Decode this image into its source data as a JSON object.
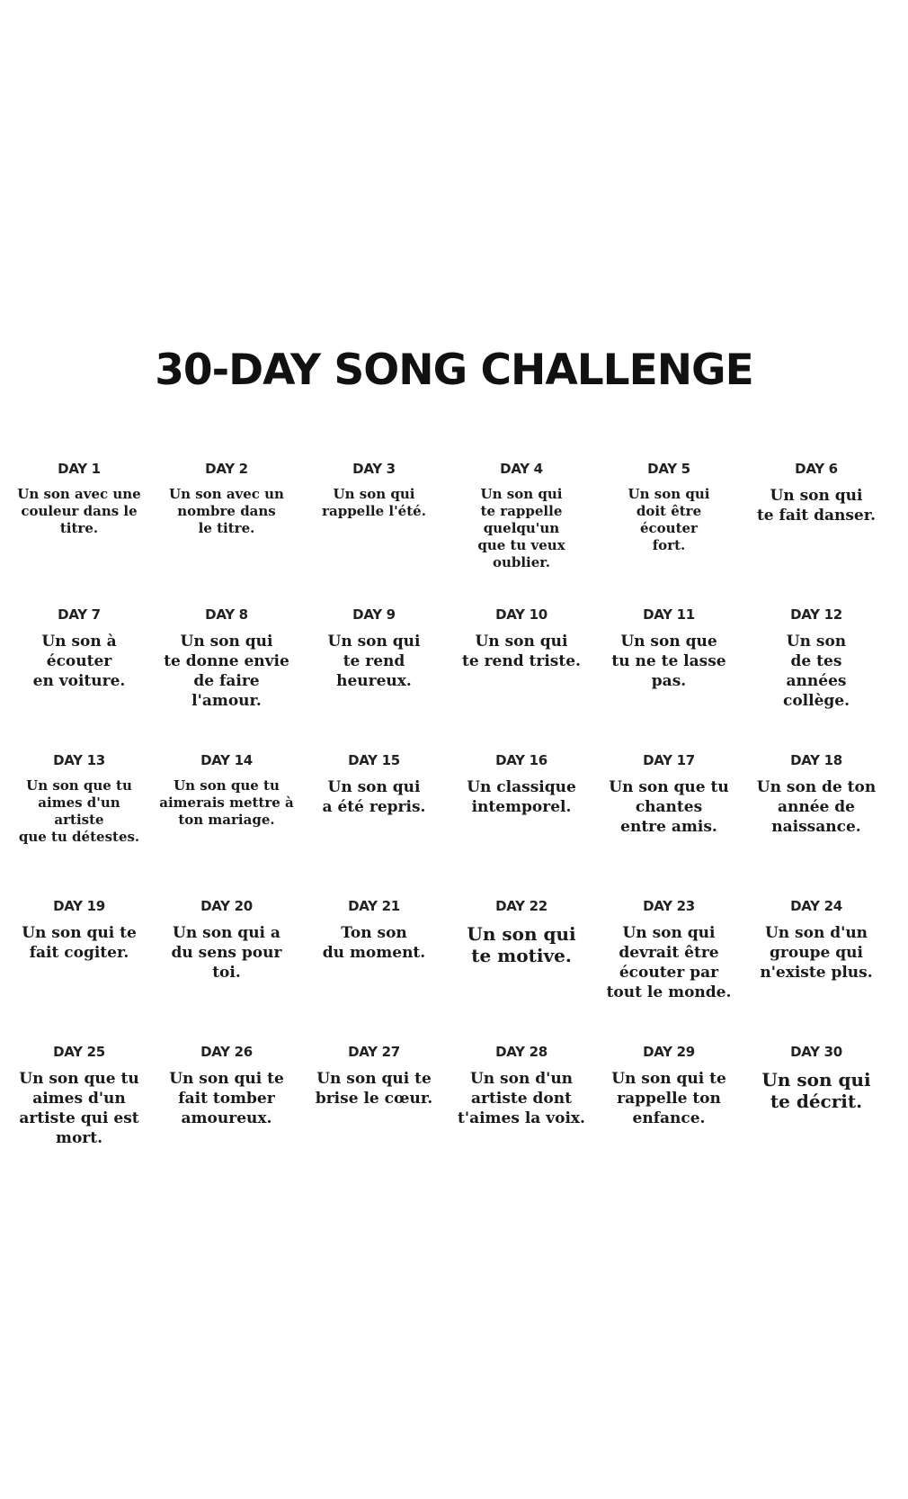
{
  "title": "30-DAY SONG CHALLENGE",
  "days": [
    {
      "label": "DAY 1",
      "text": "Un son avec une\ncouleur dans le\ntitre."
    },
    {
      "label": "DAY 2",
      "text": "Un son avec un\nnombre dans\nle titre."
    },
    {
      "label": "DAY 3",
      "text": "Un son qui\nrappelle l'été."
    },
    {
      "label": "DAY 4",
      "text": "Un son qui\nte rappelle\nquelqu'un\nque tu veux\noublier."
    },
    {
      "label": "DAY 5",
      "text": "Un son qui\ndoit être\nécouter\nfort."
    },
    {
      "label": "DAY 6",
      "text": "Un son qui\nte fait danser."
    },
    {
      "label": "DAY 7",
      "text": "Un son à\nécouter\nen voiture."
    },
    {
      "label": "DAY 8",
      "text": "Un son qui\nte donne envie\nde faire l'amour."
    },
    {
      "label": "DAY 9",
      "text": "Un son qui\nte rend\nheureux."
    },
    {
      "label": "DAY 10",
      "text": "Un son qui\nte rend triste."
    },
    {
      "label": "DAY 11",
      "text": "Un son que\ntu ne te lasse\npas."
    },
    {
      "label": "DAY 12",
      "text": "Un son\nde tes\nannées\ncollège."
    },
    {
      "label": "DAY 13",
      "text": "Un son que tu\naimes d'un\nartiste\nque tu détestes."
    },
    {
      "label": "DAY 14",
      "text": "Un son que tu\naimerais mettre à\nton mariage."
    },
    {
      "label": "DAY 15",
      "text": "Un son qui\na été repris."
    },
    {
      "label": "DAY 16",
      "text": "Un classique\nintemporel."
    },
    {
      "label": "DAY 17",
      "text": "Un son que tu\nchantes\nentre amis."
    },
    {
      "label": "DAY 18",
      "text": "Un son de ton\nannée de\nnaissance."
    },
    {
      "label": "DAY 19",
      "text": "Un son qui te\nfait cogiter."
    },
    {
      "label": "DAY 20",
      "text": "Un son qui a\ndu sens pour\ntoi."
    },
    {
      "label": "DAY 21",
      "text": "Ton son\ndu moment."
    },
    {
      "label": "DAY 22",
      "text": "Un son qui\nte motive."
    },
    {
      "label": "DAY 23",
      "text": "Un son qui\ndevrait être\nécouter par\ntout le monde."
    },
    {
      "label": "DAY 24",
      "text": "Un son d'un\ngroupe qui\nn'existe plus."
    },
    {
      "label": "DAY 25",
      "text": "Un son que tu\naimes d'un\nartiste qui est\nmort."
    },
    {
      "label": "DAY 26",
      "text": "Un son qui te\nfait tomber\namoureux."
    },
    {
      "label": "DAY 27",
      "text": "Un son qui te\nbrise le cœur."
    },
    {
      "label": "DAY 28",
      "text": "Un son d'un\nartiste dont\nt'aimes la voix."
    },
    {
      "label": "DAY 29",
      "text": "Un son qui te\nrappelle ton\nenfance."
    },
    {
      "label": "DAY 30",
      "text": "Un son qui\nte décrit."
    }
  ]
}
